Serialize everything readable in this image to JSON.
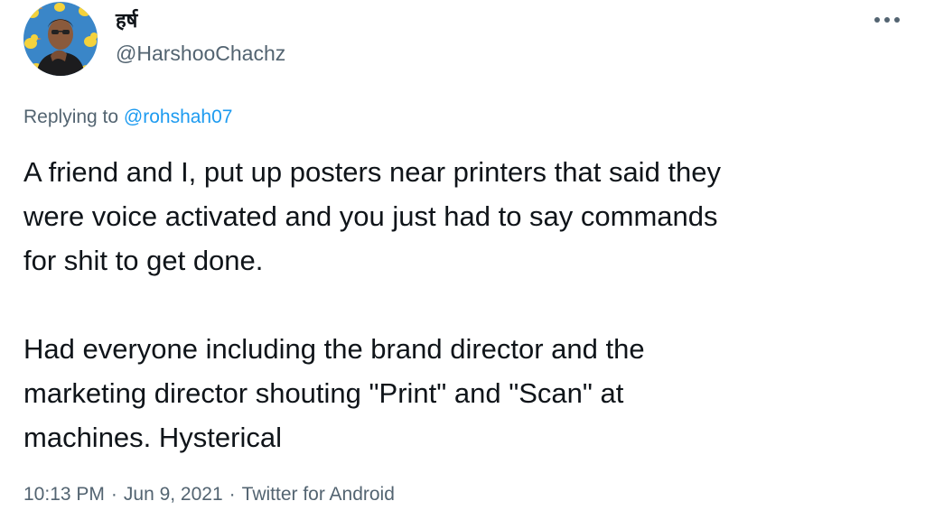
{
  "author": {
    "display_name": "हर्ष",
    "handle": "@HarshooChachz",
    "avatar_icon": "profile-photo-duck-wallpaper"
  },
  "more_icon": "more-horizontal-icon",
  "reply": {
    "prefix": "Replying to",
    "mention": "@rohshah07"
  },
  "body": {
    "paragraph_1": [
      "A friend and I, put up posters near printers that said they",
      "were voice activated and you just had to say commands",
      "for shit to get done."
    ],
    "paragraph_2": [
      "Had everyone including the brand director and the",
      "marketing director shouting \"Print\" and \"Scan\" at",
      "machines. Hysterical"
    ]
  },
  "meta": {
    "time": "10:13 PM",
    "separator": "·",
    "date": "Jun 9, 2021",
    "source": "Twitter for Android"
  },
  "colors": {
    "text": "#0f1419",
    "secondary": "#536471",
    "link": "#1d9bf0",
    "background": "#ffffff"
  }
}
